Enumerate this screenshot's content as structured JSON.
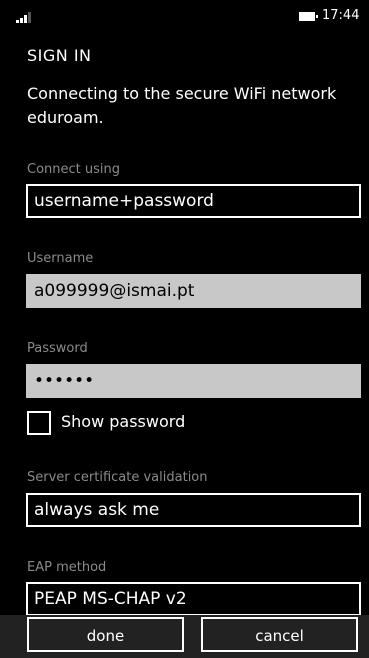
{
  "status_bar": {
    "time": "17:44"
  },
  "header": {
    "title": "SIGN IN"
  },
  "intro_text": "Connecting to the secure WiFi network eduroam.",
  "connect_using": {
    "label": "Connect using",
    "value": "username+password"
  },
  "username": {
    "label": "Username",
    "value": "a099999@ismai.pt"
  },
  "password": {
    "label": "Password",
    "value": "••••••"
  },
  "show_password": {
    "label": "Show password",
    "checked": false
  },
  "server_cert": {
    "label": "Server certificate validation",
    "value": "always ask me"
  },
  "eap_method": {
    "label": "EAP method",
    "value": "PEAP MS-CHAP v2"
  },
  "app_bar": {
    "done_label": "done",
    "cancel_label": "cancel"
  },
  "colors": {
    "background": "#000000",
    "field_filled": "#c8c8c8",
    "label_gray": "#8a8a8a",
    "app_bar": "#222222"
  },
  "icons": [
    "signal-strength-icon",
    "battery-icon"
  ]
}
